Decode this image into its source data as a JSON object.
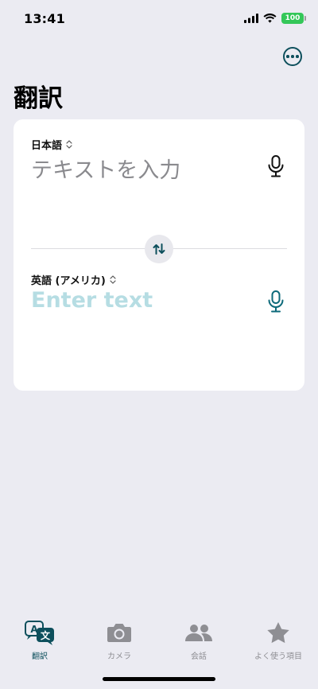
{
  "status_bar": {
    "time": "13:41",
    "battery": "100"
  },
  "header": {
    "title": "翻訳",
    "more_icon": "ellipsis-circle-icon"
  },
  "source": {
    "language": "日本語",
    "placeholder": "テキストを入力",
    "mic_icon": "microphone-icon"
  },
  "target": {
    "language": "英語 (アメリカ)",
    "placeholder": "Enter text",
    "mic_icon": "microphone-icon"
  },
  "swap": {
    "icon": "swap-arrows-icon"
  },
  "tabs": [
    {
      "label": "翻訳",
      "icon": "translate-icon",
      "active": true
    },
    {
      "label": "カメラ",
      "icon": "camera-icon",
      "active": false
    },
    {
      "label": "会話",
      "icon": "people-icon",
      "active": false
    },
    {
      "label": "よく使う項目",
      "icon": "star-icon",
      "active": false
    }
  ],
  "colors": {
    "accent": "#0d4f5c",
    "target_placeholder": "#b6dde3",
    "background": "#ebebf2",
    "card": "#ffffff",
    "battery": "#34c759"
  }
}
